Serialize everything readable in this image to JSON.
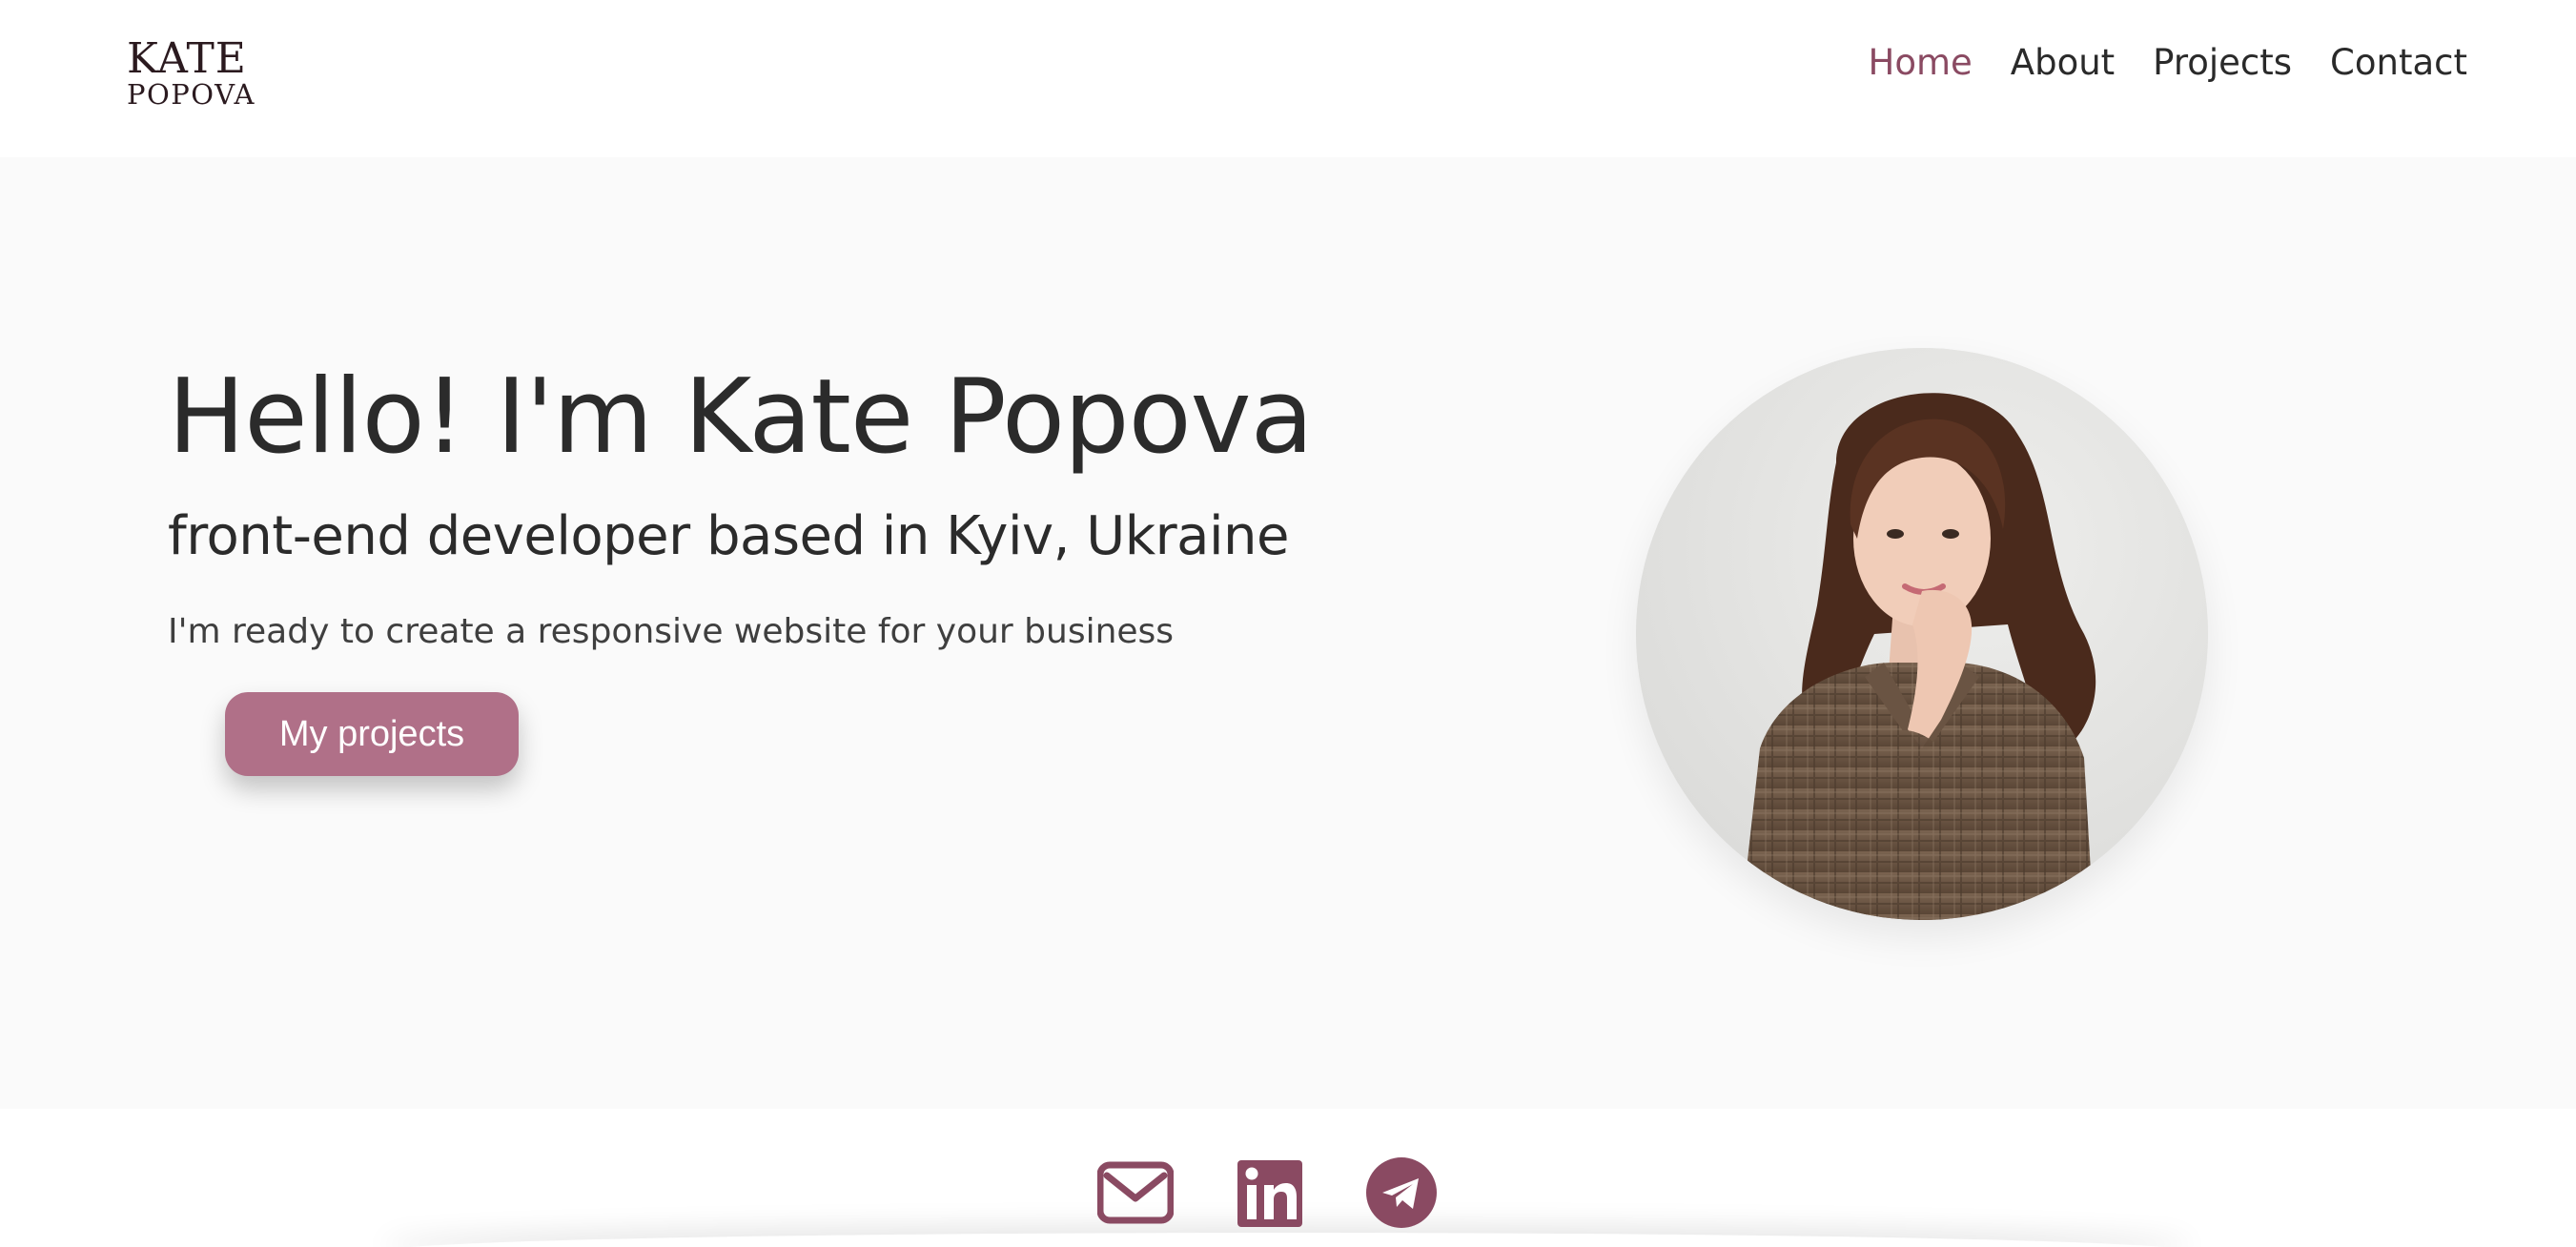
{
  "header": {
    "logo": {
      "line1": "KATE",
      "line2": "POPOVA"
    },
    "nav": [
      {
        "label": "Home",
        "active": true
      },
      {
        "label": "About",
        "active": false
      },
      {
        "label": "Projects",
        "active": false
      },
      {
        "label": "Contact",
        "active": false
      }
    ]
  },
  "hero": {
    "title": "Hello! I'm Kate Popova",
    "subtitle": "front-end developer based in Kyiv, Ukraine",
    "text": "I'm ready to create a responsive website for your business",
    "button_label": "My projects"
  },
  "socials": [
    {
      "icon": "envelope-icon"
    },
    {
      "icon": "linkedin-icon"
    },
    {
      "icon": "telegram-icon"
    }
  ],
  "colors": {
    "accent": "#8a4a62",
    "button": "#b07088",
    "hero_bg": "#fafafa",
    "text": "#2b2b2b"
  }
}
